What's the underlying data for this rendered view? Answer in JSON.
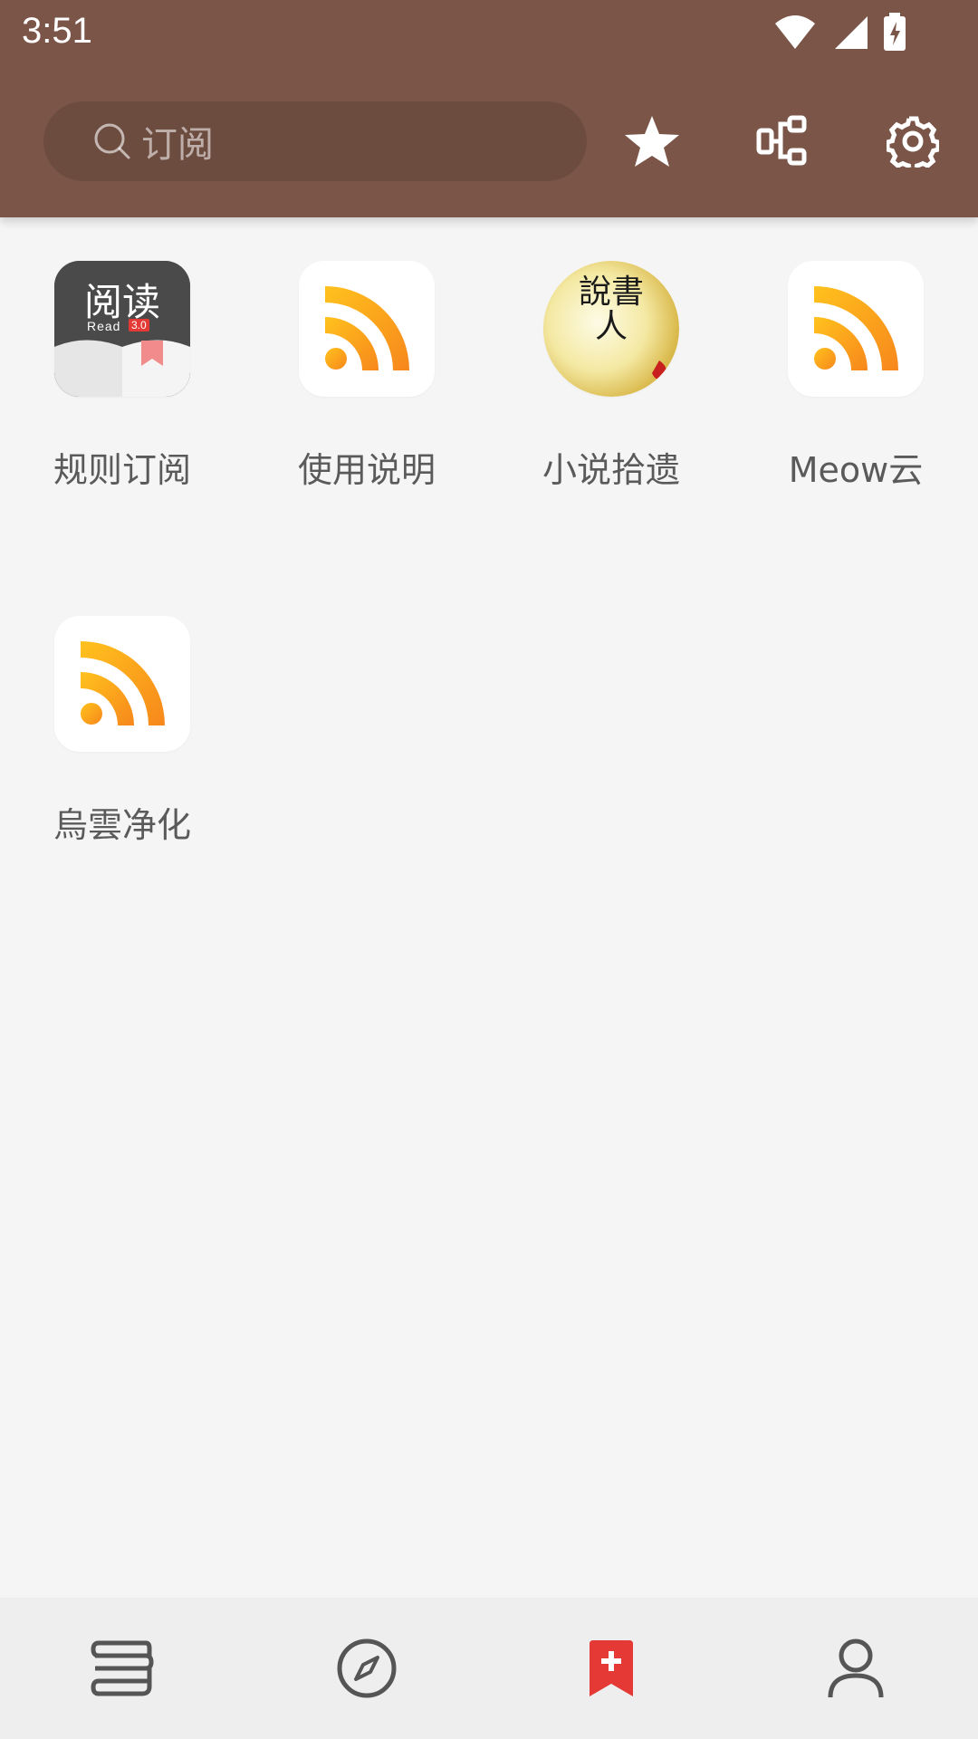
{
  "status_bar": {
    "time": "3:51"
  },
  "search": {
    "placeholder": "订阅"
  },
  "colors": {
    "topbar": "#7a5548",
    "accent": "#e53935",
    "rss_orange": "#f7941d"
  },
  "top_actions": [
    {
      "icon": "star-icon"
    },
    {
      "icon": "rule-group-icon"
    },
    {
      "icon": "gear-icon"
    }
  ],
  "subscriptions": [
    {
      "label": "规则订阅",
      "icon": "read-app-icon",
      "logo_text": "阅读",
      "logo_sub": "Read",
      "logo_ver": "3.0"
    },
    {
      "label": "使用说明",
      "icon": "rss-icon"
    },
    {
      "label": "小说拾遗",
      "icon": "storyteller-icon",
      "logo_text": "說書人"
    },
    {
      "label": "Meow云",
      "icon": "rss-icon"
    },
    {
      "label": "烏雲净化",
      "icon": "rss-icon"
    }
  ],
  "bottom_nav": [
    {
      "icon": "bookshelf-icon",
      "active": false
    },
    {
      "icon": "compass-icon",
      "active": false
    },
    {
      "icon": "rss-bookmark-icon",
      "active": true
    },
    {
      "icon": "person-icon",
      "active": false
    }
  ]
}
